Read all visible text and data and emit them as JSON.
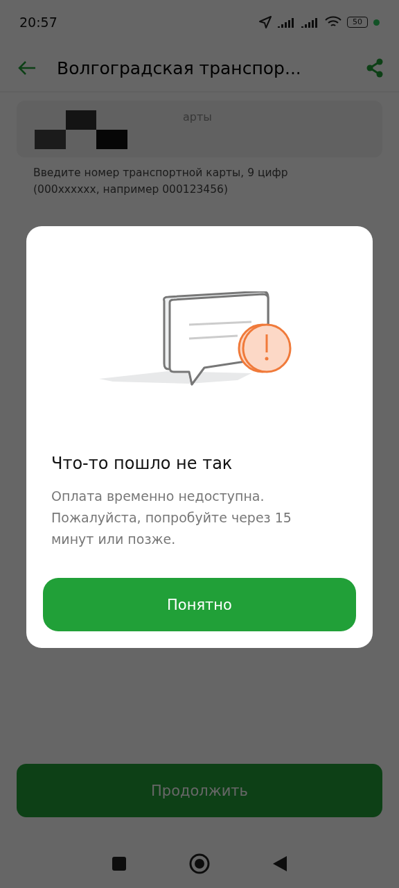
{
  "status_bar": {
    "time": "20:57",
    "battery": "50"
  },
  "app_bar": {
    "title": "Волгоградская транспор..."
  },
  "card_field": {
    "label": "арты",
    "helper": "Введите номер транспортной карты, 9 цифр (000xxxxxx, например 000123456)"
  },
  "continue_button": {
    "label": "Продолжить"
  },
  "dialog": {
    "title": "Что-то пошло не так",
    "message": "Оплата временно недоступна. Пожалуйста, попробуйте через 15 минут или позже.",
    "button": "Понятно"
  }
}
